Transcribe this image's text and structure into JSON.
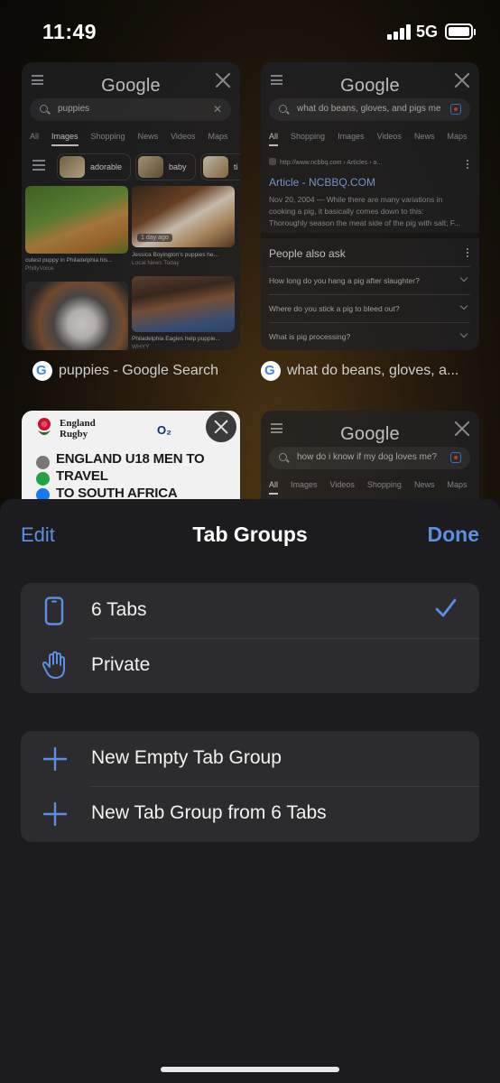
{
  "status_bar": {
    "time": "11:49",
    "network": "5G"
  },
  "tabs": [
    {
      "label": "puppies - Google Search",
      "google_logo": "Google",
      "query": "puppies",
      "search_tabs": [
        "All",
        "Images",
        "Shopping",
        "News",
        "Videos",
        "Maps"
      ],
      "active_tab": "Images",
      "chips": [
        "adorable",
        "baby",
        "ti"
      ],
      "images": [
        {
          "caption": "cutest puppy in Philadelphia his...",
          "source": "PhillyVoice"
        },
        {
          "caption": "Jessica Boyington's puppies he...",
          "source": "Local News Today",
          "badge": "1 day ago"
        },
        {
          "caption": "",
          "source": ""
        },
        {
          "caption": "Philadelphia Eagles help puppie...",
          "source": "WHYY"
        }
      ]
    },
    {
      "label": "what do beans, gloves, a...",
      "google_logo": "Google",
      "query": "what do beans, gloves, and pigs me",
      "search_tabs": [
        "All",
        "Shopping",
        "Images",
        "Videos",
        "News",
        "Maps"
      ],
      "active_tab": "All",
      "result": {
        "url": "http://www.ncbbq.com › Articles › a...",
        "title": "Article - NCBBQ.COM",
        "snippet": [
          "Nov 20, 2004 — While there are many variations in",
          "cooking a pig, it basically comes down to this:",
          "Thoroughly season the meat side of the pig with salt; F..."
        ]
      },
      "people_also_ask": {
        "title": "People also ask",
        "questions": [
          "How long do you hang a pig after slaughter?",
          "Where do you stick a pig to bleed out?",
          "What is pig processing?"
        ]
      }
    },
    {
      "site_name_line1": "England",
      "site_name_line2": "Rugby",
      "sponsor": "O₂",
      "headline_line1": "ENGLAND U18 MEN TO TRAVEL",
      "headline_line2": "TO SOUTH AFRICA"
    },
    {
      "google_logo": "Google",
      "query": "how do i know if my dog loves me?",
      "search_tabs": [
        "All",
        "Images",
        "Videos",
        "Shopping",
        "News",
        "Maps"
      ],
      "active_tab": "All"
    }
  ],
  "sheet": {
    "edit_label": "Edit",
    "title": "Tab Groups",
    "done_label": "Done",
    "groups": [
      {
        "label": "6 Tabs",
        "icon": "phone-icon",
        "selected": true
      },
      {
        "label": "Private",
        "icon": "hand-icon",
        "selected": false
      }
    ],
    "actions": [
      {
        "label": "New Empty Tab Group",
        "icon": "plus-icon"
      },
      {
        "label": "New Tab Group from 6 Tabs",
        "icon": "plus-icon"
      }
    ]
  },
  "colors": {
    "accent": "#5b8fe0",
    "sheet_bg": "#1c1c1e",
    "row_bg": "#2c2c2e"
  }
}
